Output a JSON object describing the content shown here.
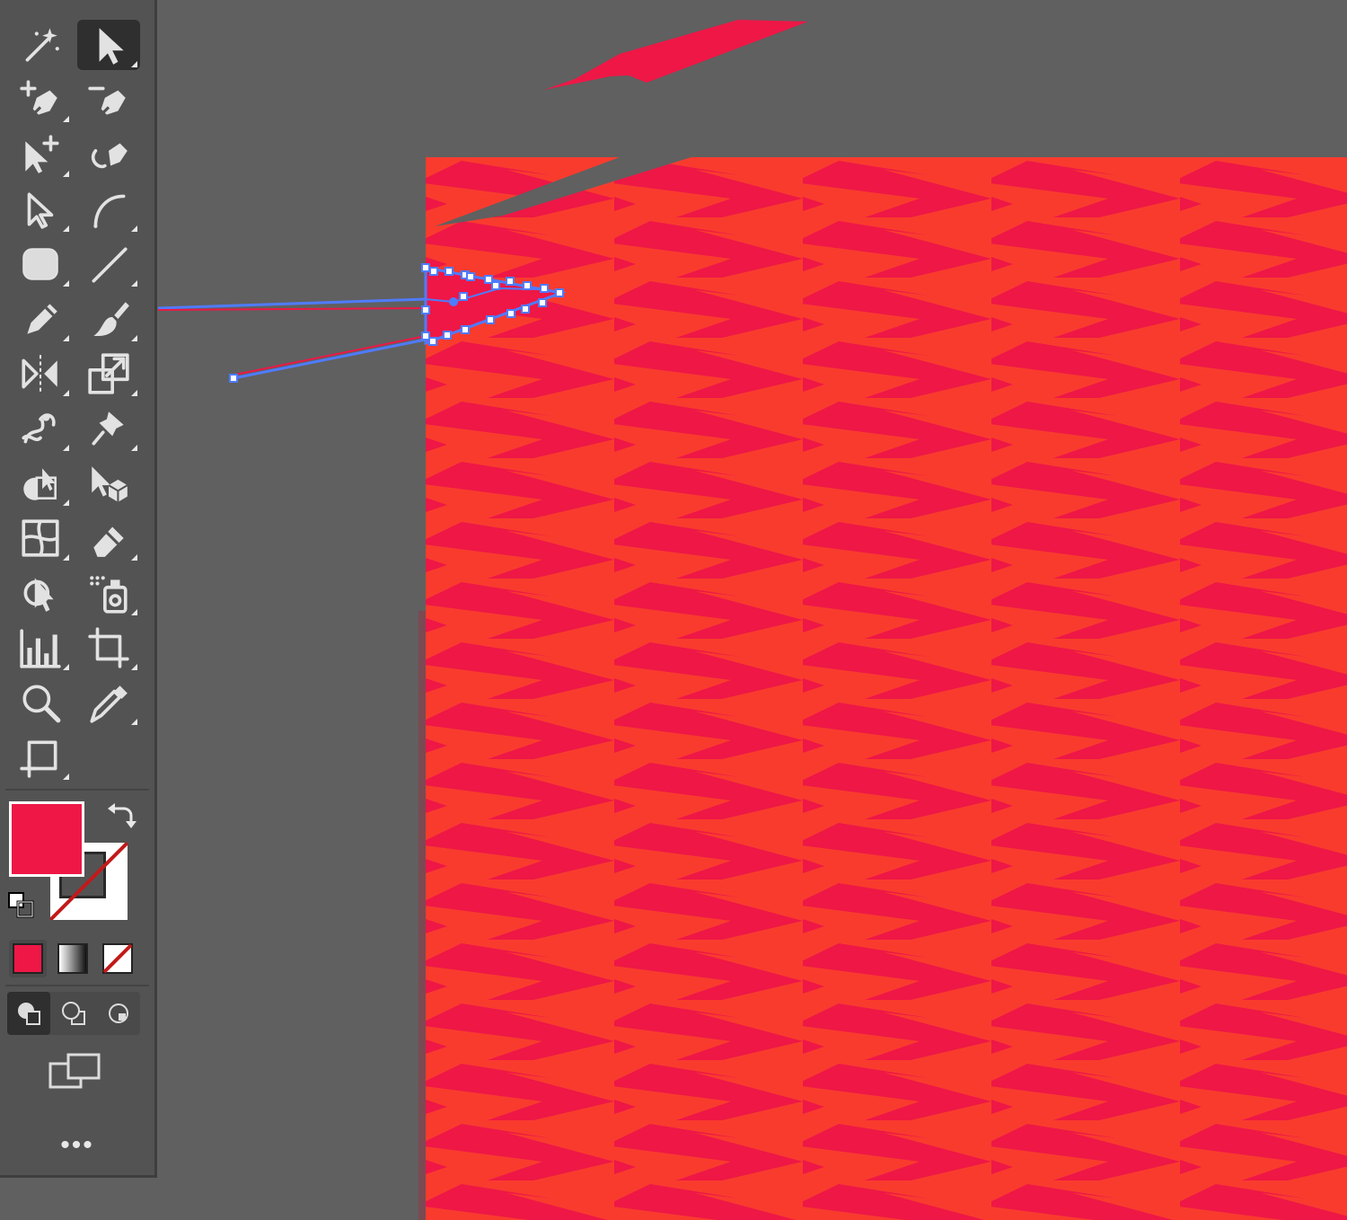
{
  "app": {
    "more_tools_label": "•••"
  },
  "colors": {
    "canvas_bg": "#606060",
    "toolbar_bg": "#535353",
    "art_base": "#f93b2e",
    "art_stripe": "#ee1746",
    "selection": "#4f7bff",
    "fill_swatch": "#ee1746",
    "stroke_none_red": "#c21a1a"
  },
  "toolbar": {
    "tools": [
      {
        "name": "magic-wand-tool",
        "icon": "magic-wand-icon",
        "active": false,
        "corner": false
      },
      {
        "name": "selection-tool",
        "icon": "arrow-select-icon",
        "active": true,
        "corner": true
      },
      {
        "name": "add-anchor-point-tool",
        "icon": "pen-plus-icon",
        "active": false,
        "corner": true
      },
      {
        "name": "delete-anchor-point-tool",
        "icon": "pen-minus-icon",
        "active": false,
        "corner": false
      },
      {
        "name": "group-selection-tool",
        "icon": "arrow-plus-icon",
        "active": false,
        "corner": true
      },
      {
        "name": "curvature-pen-tool",
        "icon": "pen-curve-icon",
        "active": false,
        "corner": false
      },
      {
        "name": "direct-selection-tool",
        "icon": "hollow-arrow-icon",
        "active": false,
        "corner": true
      },
      {
        "name": "curvature-tool",
        "icon": "arc-icon",
        "active": false,
        "corner": true
      },
      {
        "name": "rounded-rectangle-tool",
        "icon": "rounded-rect-icon",
        "active": false,
        "corner": true
      },
      {
        "name": "line-segment-tool",
        "icon": "line-icon",
        "active": false,
        "corner": true
      },
      {
        "name": "pencil-tool",
        "icon": "pencil-icon",
        "active": false,
        "corner": true
      },
      {
        "name": "paintbrush-tool",
        "icon": "brush-icon",
        "active": false,
        "corner": true
      },
      {
        "name": "reflect-tool",
        "icon": "reflect-icon",
        "active": false,
        "corner": true
      },
      {
        "name": "scale-tool",
        "icon": "scale-icon",
        "active": false,
        "corner": true
      },
      {
        "name": "warp-tool",
        "icon": "warp-icon",
        "active": false,
        "corner": true
      },
      {
        "name": "puppet-warp-tool",
        "icon": "pin-icon",
        "active": false,
        "corner": true
      },
      {
        "name": "shape-builder-tool",
        "icon": "shape-builder-icon",
        "active": false,
        "corner": true
      },
      {
        "name": "perspective-selection-tool",
        "icon": "cube-arrow-icon",
        "active": false,
        "corner": false
      },
      {
        "name": "mesh-tool",
        "icon": "mesh-icon",
        "active": false,
        "corner": true
      },
      {
        "name": "eraser-tool",
        "icon": "eraser-icon",
        "active": false,
        "corner": true
      },
      {
        "name": "blend-tool",
        "icon": "blend-icon",
        "active": false,
        "corner": false
      },
      {
        "name": "symbol-sprayer-tool",
        "icon": "spray-icon",
        "active": false,
        "corner": true
      },
      {
        "name": "graph-tool",
        "icon": "bar-graph-icon",
        "active": false,
        "corner": true
      },
      {
        "name": "crop-artboard-tool",
        "icon": "crop-icon",
        "active": false,
        "corner": true
      },
      {
        "name": "zoom-tool",
        "icon": "magnifier-icon",
        "active": false,
        "corner": false
      },
      {
        "name": "eyedropper-tool",
        "icon": "eyedropper-icon",
        "active": false,
        "corner": true
      },
      {
        "name": "artboard-tool",
        "icon": "artboard-icon",
        "active": false,
        "corner": true
      }
    ]
  }
}
